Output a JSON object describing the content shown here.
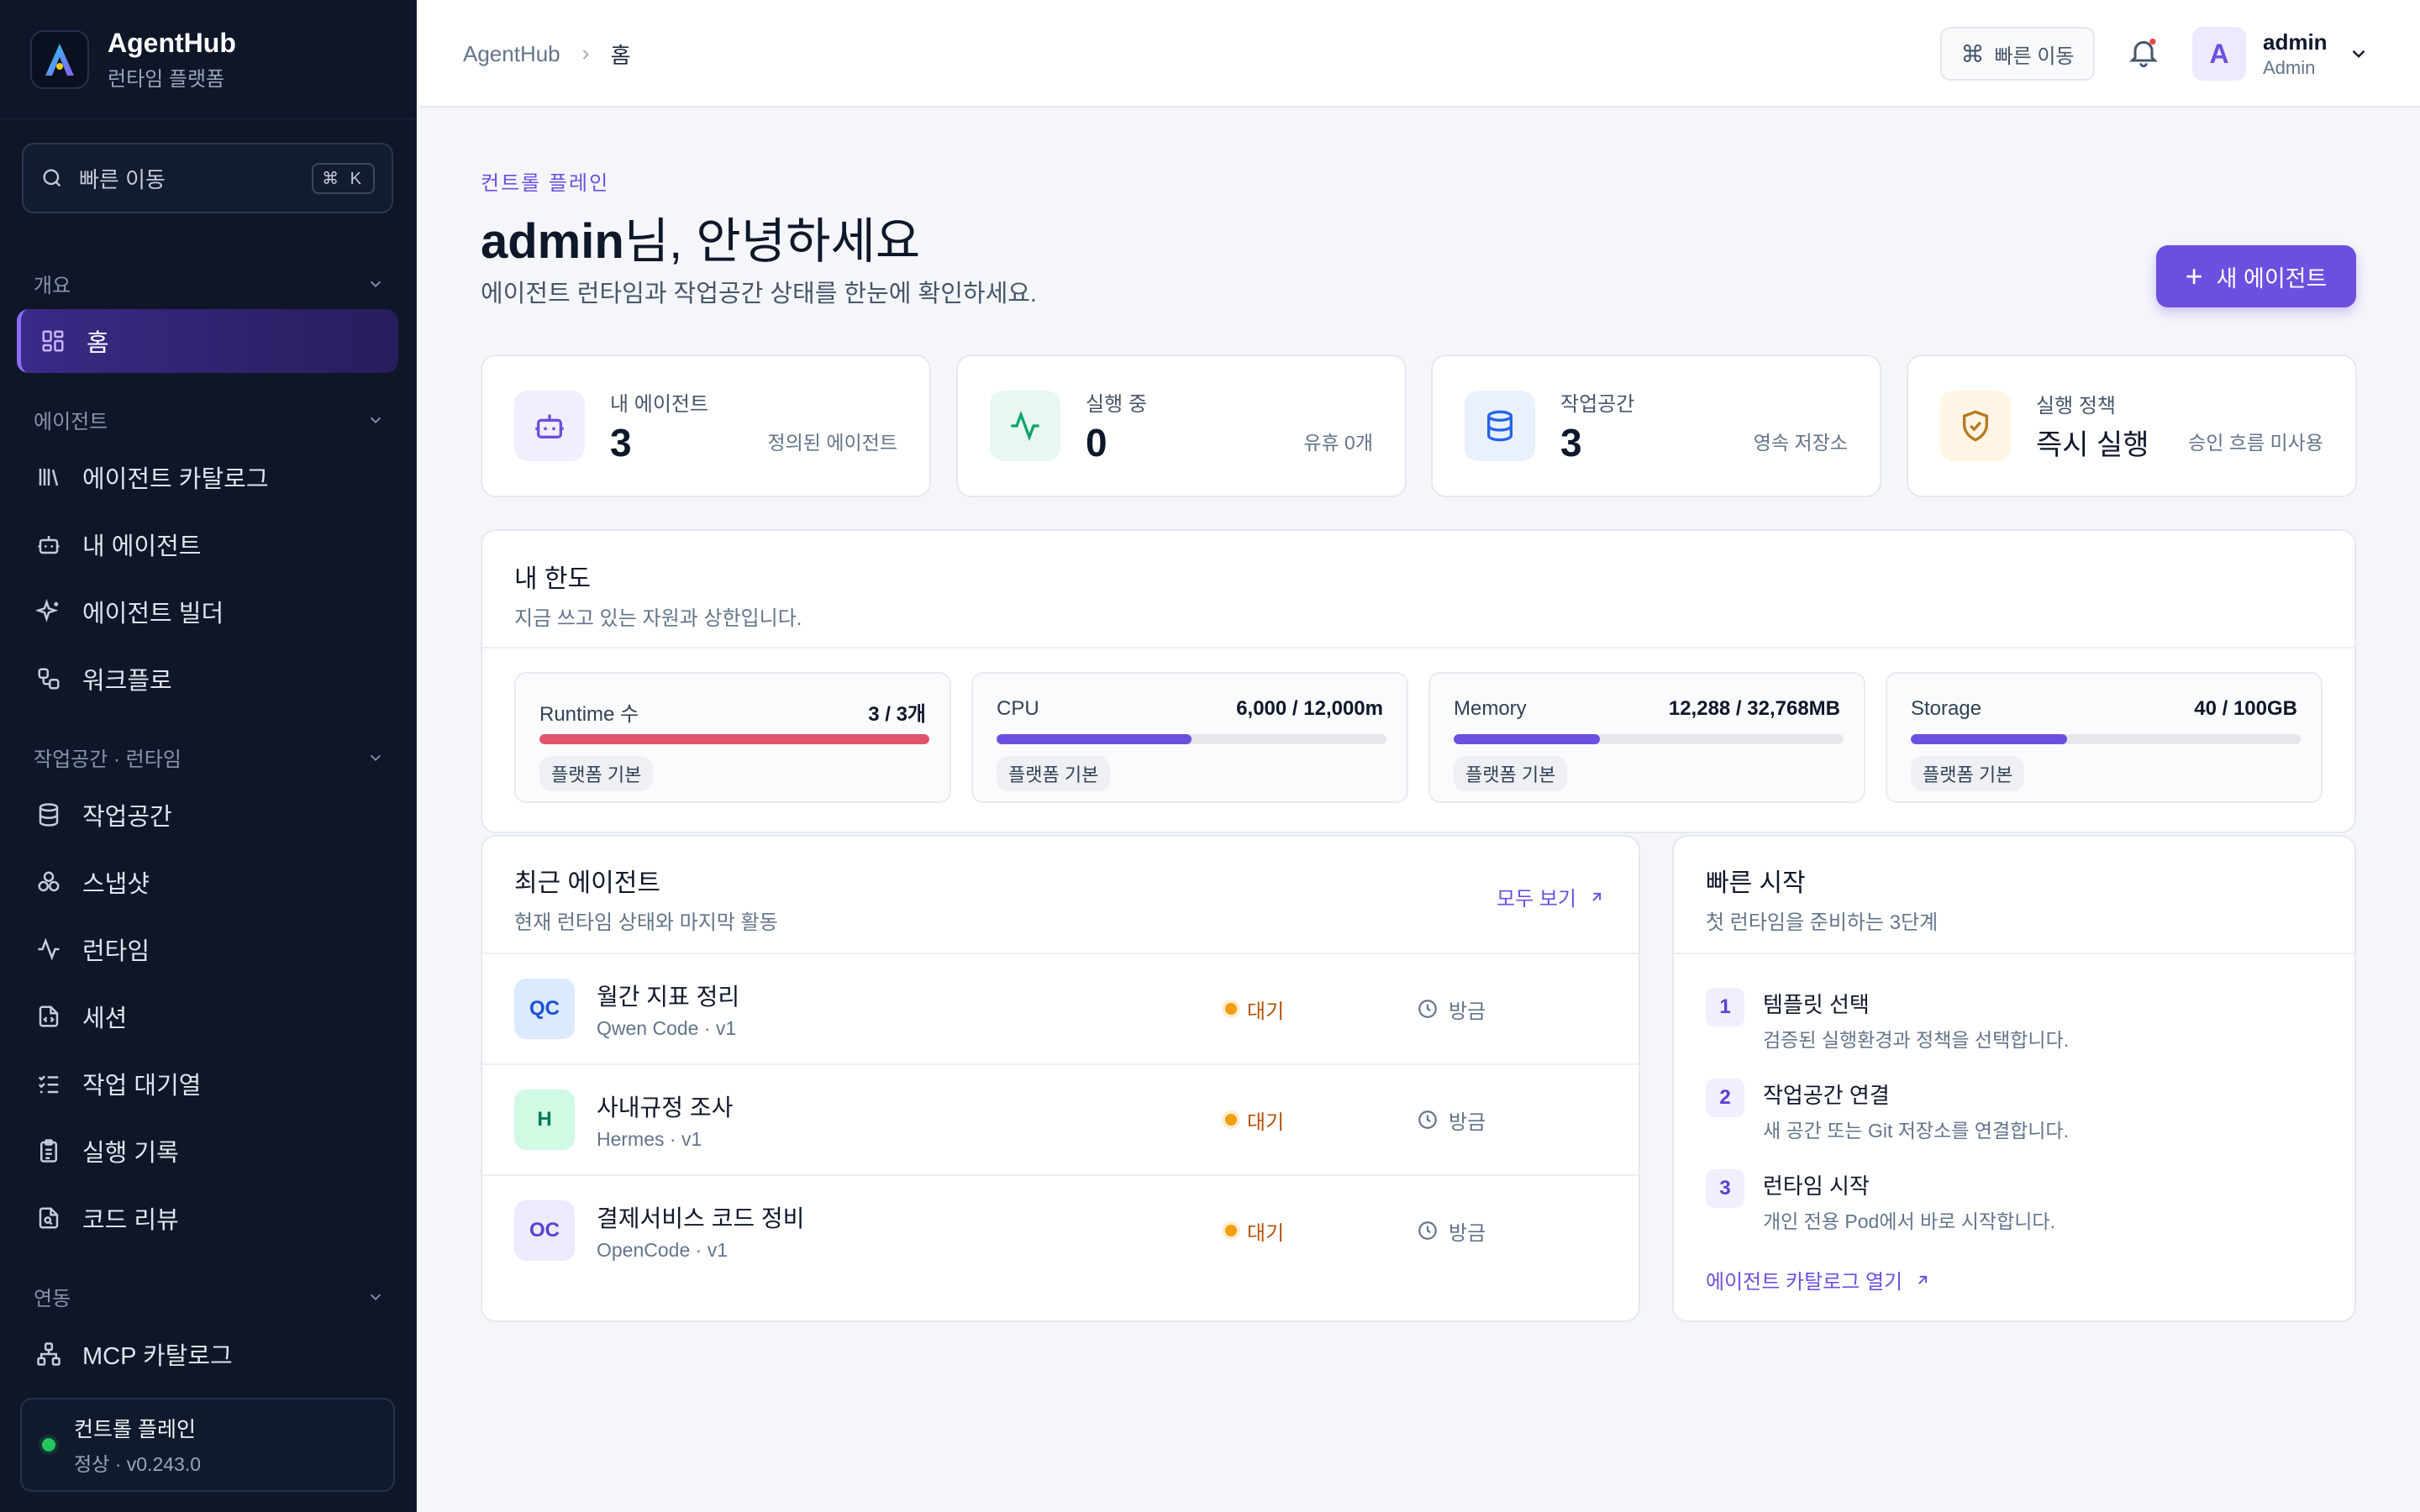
{
  "brand": {
    "name": "AgentHub",
    "subtitle": "런타임 플랫폼"
  },
  "search": {
    "placeholder": "빠른 이동",
    "shortcut": "⌘ K"
  },
  "sidebar": {
    "sections": [
      {
        "title": "개요",
        "items": [
          {
            "label": "홈",
            "icon": "grid-icon",
            "active": true
          }
        ]
      },
      {
        "title": "에이전트",
        "items": [
          {
            "label": "에이전트 카탈로그",
            "icon": "library-icon"
          },
          {
            "label": "내 에이전트",
            "icon": "bot-icon"
          },
          {
            "label": "에이전트 빌더",
            "icon": "sparkles-icon"
          },
          {
            "label": "워크플로",
            "icon": "workflow-icon"
          }
        ]
      },
      {
        "title": "작업공간 · 런타임",
        "items": [
          {
            "label": "작업공간",
            "icon": "database-icon"
          },
          {
            "label": "스냅샷",
            "icon": "boxes-icon"
          },
          {
            "label": "런타임",
            "icon": "activity-icon"
          },
          {
            "label": "세션",
            "icon": "file-code-icon"
          },
          {
            "label": "작업 대기열",
            "icon": "list-checks-icon"
          },
          {
            "label": "실행 기록",
            "icon": "clipboard-icon"
          },
          {
            "label": "코드 리뷰",
            "icon": "file-search-icon"
          }
        ]
      },
      {
        "title": "연동",
        "items": [
          {
            "label": "MCP 카탈로그",
            "icon": "network-icon"
          }
        ]
      }
    ],
    "status": {
      "title": "컨트롤 플레인",
      "detail": "정상 · v0.243.0",
      "color": "#22c55e"
    }
  },
  "header": {
    "breadcrumb": [
      "AgentHub",
      "홈"
    ],
    "quick_nav": "빠른 이동",
    "user": {
      "initial": "A",
      "name": "admin",
      "role": "Admin"
    }
  },
  "hero": {
    "eyebrow": "컨트롤 플레인",
    "greeting_name": "admin",
    "greeting_rest": "님, 안녕하세요",
    "subtitle": "에이전트 런타임과 작업공간 상태를 한눈에 확인하세요.",
    "new_button": "새 에이전트"
  },
  "stats": [
    {
      "label": "내 에이전트",
      "value": "3",
      "note": "정의된 에이전트",
      "icon": "bot-icon"
    },
    {
      "label": "실행 중",
      "value": "0",
      "note": "유휴 0개",
      "icon": "activity-icon"
    },
    {
      "label": "작업공간",
      "value": "3",
      "note": "영속 저장소",
      "icon": "database-icon"
    },
    {
      "label": "실행 정책",
      "value": "즉시 실행",
      "note": "승인 흐름 미사용",
      "icon": "shield-check-icon"
    }
  ],
  "quota": {
    "title": "내 한도",
    "subtitle": "지금 쓰고 있는 자원과 상한입니다.",
    "items": [
      {
        "label": "Runtime 수",
        "value": "3 / 3개",
        "ratio": 1.0,
        "tag": "플랫폼 기본",
        "color": "#e0546c"
      },
      {
        "label": "CPU",
        "value": "6,000 / 12,000m",
        "ratio": 0.5,
        "tag": "플랫폼 기본",
        "color": "#6d4fe0"
      },
      {
        "label": "Memory",
        "value": "12,288 / 32,768MB",
        "ratio": 0.375,
        "tag": "플랫폼 기본",
        "color": "#6d4fe0"
      },
      {
        "label": "Storage",
        "value": "40 / 100GB",
        "ratio": 0.4,
        "tag": "플랫폼 기본",
        "color": "#6d4fe0"
      }
    ]
  },
  "recent": {
    "title": "최근 에이전트",
    "subtitle": "현재 런타임 상태와 마지막 활동",
    "view_all": "모두 보기",
    "agents": [
      {
        "badge": "QC",
        "name": "월간 지표 정리",
        "meta": "Qwen Code · v1",
        "status": "대기",
        "time": "방금",
        "badge_bg": "#dbeafe",
        "badge_fg": "#1d4ed8"
      },
      {
        "badge": "H",
        "name": "사내규정 조사",
        "meta": "Hermes · v1",
        "status": "대기",
        "time": "방금",
        "badge_bg": "#d1fae5",
        "badge_fg": "#047857"
      },
      {
        "badge": "OC",
        "name": "결제서비스 코드 정비",
        "meta": "OpenCode · v1",
        "status": "대기",
        "time": "방금",
        "badge_bg": "#ede9fe",
        "badge_fg": "#5b3fd0"
      }
    ]
  },
  "quickstart": {
    "title": "빠른 시작",
    "subtitle": "첫 런타임을 준비하는 3단계",
    "steps": [
      {
        "num": "1",
        "title": "템플릿 선택",
        "desc": "검증된 실행환경과 정책을 선택합니다."
      },
      {
        "num": "2",
        "title": "작업공간 연결",
        "desc": "새 공간 또는 Git 저장소를 연결합니다."
      },
      {
        "num": "3",
        "title": "런타임 시작",
        "desc": "개인 전용 Pod에서 바로 시작합니다."
      }
    ],
    "link": "에이전트 카탈로그 열기"
  }
}
